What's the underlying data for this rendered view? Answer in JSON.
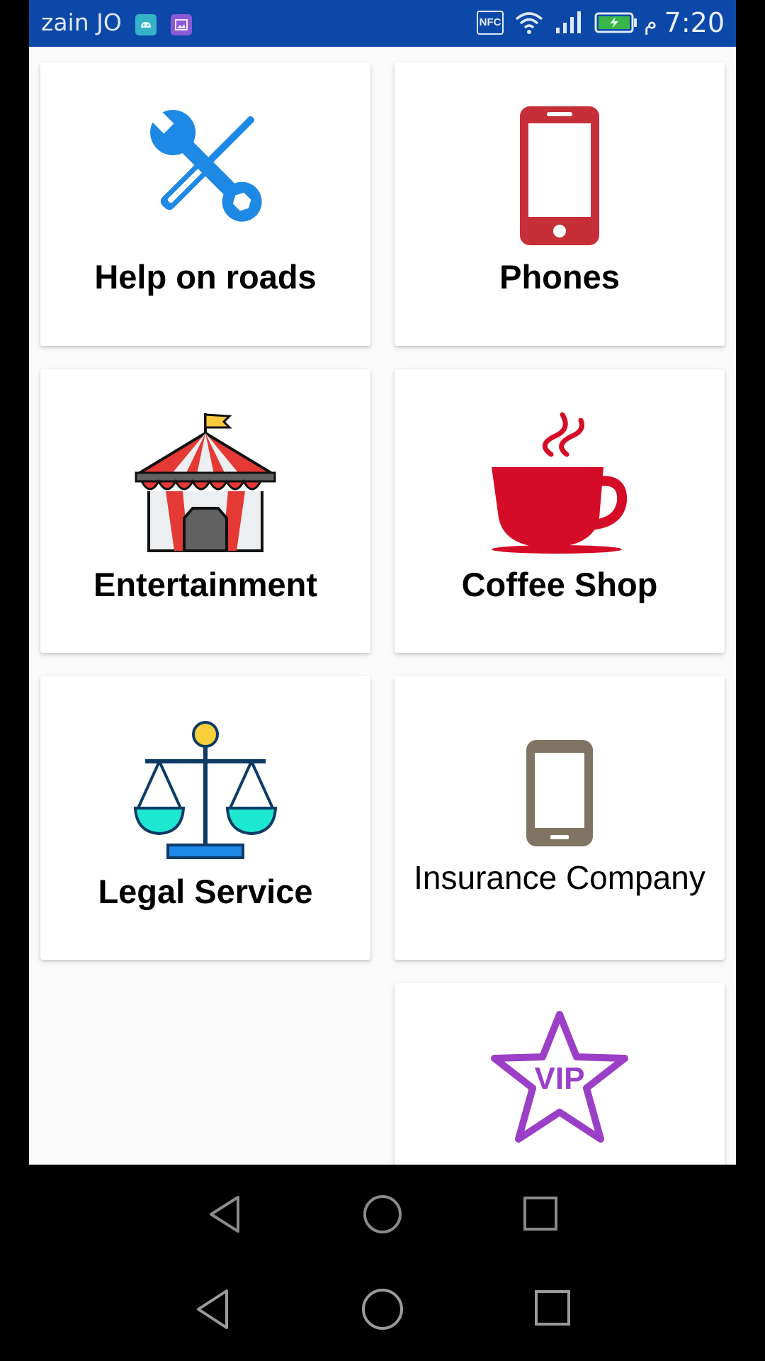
{
  "status_bar": {
    "carrier": "zain JO",
    "nfc": "NFC",
    "ampm": "م",
    "time": "7:20",
    "background": "#0c48a8"
  },
  "tiles": [
    {
      "label": "Help on roads",
      "icon": "wrench-screwdriver-icon",
      "color": "#1e88e5"
    },
    {
      "label": "Phones",
      "icon": "smartphone-icon",
      "color": "#c62f37"
    },
    {
      "label": "Entertainment",
      "icon": "circus-tent-icon",
      "color": "#e53935"
    },
    {
      "label": "Coffee Shop",
      "icon": "coffee-cup-icon",
      "color": "#d50c27"
    },
    {
      "label": "Legal Service",
      "icon": "scales-of-justice-icon",
      "color": "#0d3b66"
    },
    {
      "label": "Insurance Company",
      "icon": "mobile-phone-icon",
      "color": "#7f7562"
    },
    {
      "label": "",
      "icon": "vip-star-icon",
      "color": "#9b3fc7"
    }
  ],
  "nav": {
    "back": "back-icon",
    "home": "home-icon",
    "recents": "recents-icon"
  }
}
